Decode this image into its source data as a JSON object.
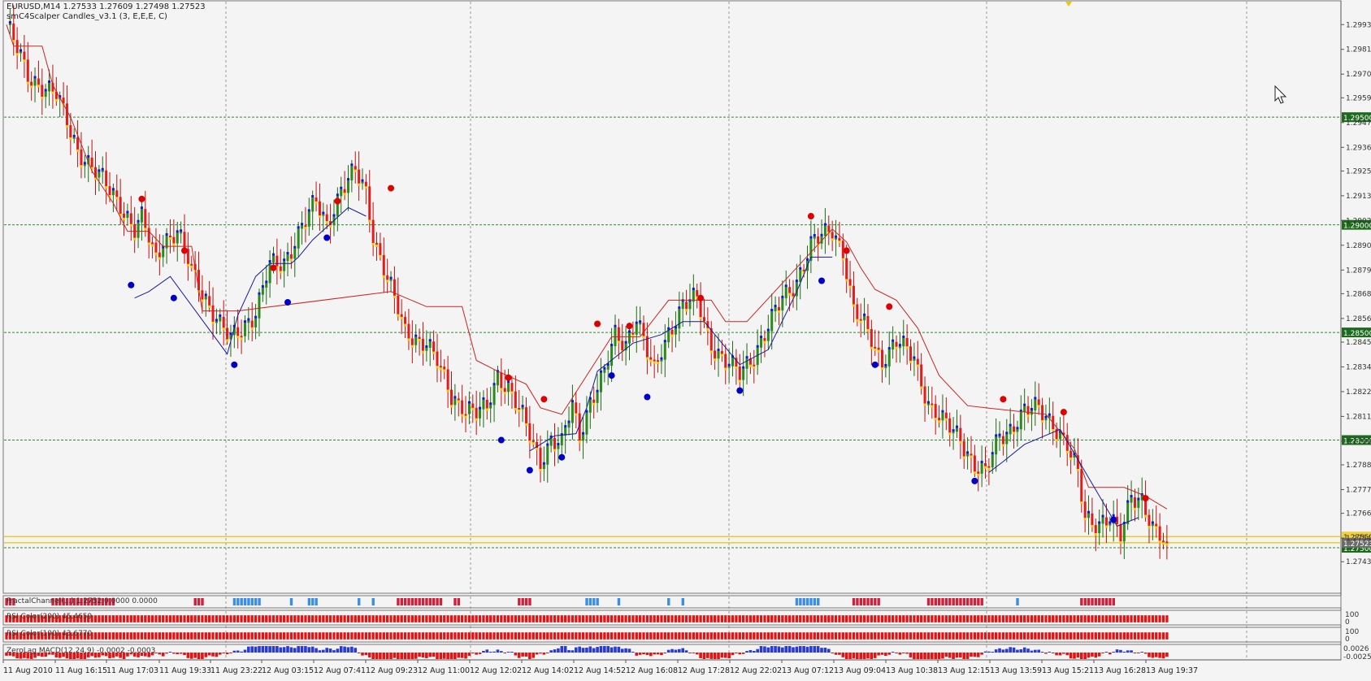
{
  "chart": {
    "symbol_line": "EURUSD,M14  1.27533 1.27609 1.27498 1.27523",
    "indicator_line": "smC4Scalper Candles_v3.1 (3, E,E,E, C)",
    "current_price": "1.27523",
    "colors": {
      "bull": "#2a8a1c",
      "bear": "#e31b1b",
      "wick": "#c01010",
      "trail_red": "#cc2222",
      "trail_blue": "#1a1a9c",
      "dot_red": "#e00000",
      "dot_blue": "#0000cc",
      "tick_gold": "#f0c800",
      "grid_h": "#2f8a2f",
      "box_green": "#1c6b1c"
    }
  },
  "chart_data": {
    "type": "candlestick",
    "title": "EURUSD,M14",
    "ylim": [
      1.27315,
      1.29999
    ],
    "price_labels": [
      "1.29930",
      "1.29815",
      "1.29700",
      "1.29590",
      "1.29475",
      "1.29360",
      "1.29250",
      "1.29135",
      "1.29020",
      "1.28905",
      "1.28790",
      "1.28680",
      "1.28565",
      "1.28455",
      "1.28340",
      "1.28225",
      "1.28110",
      "1.27995",
      "1.27885",
      "1.27770",
      "1.27660",
      "1.27545",
      "1.27435"
    ],
    "levels": [
      {
        "value": 1.295,
        "label": "1.29500"
      },
      {
        "value": 1.29,
        "label": "1.29000"
      },
      {
        "value": 1.285,
        "label": "1.28500"
      },
      {
        "value": 1.28,
        "label": "1.28000"
      },
      {
        "value": 1.275,
        "label": "1.27500"
      }
    ],
    "yellow_levels": [
      {
        "value": 1.27552,
        "label": "1.27552"
      },
      {
        "value": 1.27523,
        "label": "1.27523"
      }
    ],
    "time_labels": [
      "11 Aug 2010",
      "11 Aug 16:15",
      "11 Aug 17:03",
      "11 Aug 19:33",
      "11 Aug 23:22",
      "12 Aug 03:15",
      "12 Aug 07:41",
      "12 Aug 09:23",
      "12 Aug 11:00",
      "12 Aug 12:02",
      "12 Aug 14:02",
      "12 Aug 14:52",
      "12 Aug 16:08",
      "12 Aug 17:28",
      "12 Aug 22:02",
      "13 Aug 07:12",
      "13 Aug 09:04",
      "13 Aug 10:38",
      "13 Aug 12:15",
      "13 Aug 13:59",
      "13 Aug 15:21",
      "13 Aug 16:28",
      "13 Aug 19:37"
    ],
    "close_path": [
      [
        0,
        1.2993
      ],
      [
        6,
        1.2969
      ],
      [
        14,
        1.296
      ],
      [
        20,
        1.2935
      ],
      [
        26,
        1.2922
      ],
      [
        32,
        1.291
      ],
      [
        36,
        1.2897
      ],
      [
        38,
        1.2902
      ],
      [
        42,
        1.2885
      ],
      [
        44,
        1.2893
      ],
      [
        48,
        1.2896
      ],
      [
        52,
        1.2879
      ],
      [
        56,
        1.2866
      ],
      [
        60,
        1.2853
      ],
      [
        63,
        1.2846
      ],
      [
        65,
        1.285
      ],
      [
        70,
        1.2859
      ],
      [
        74,
        1.288
      ],
      [
        78,
        1.2882
      ],
      [
        82,
        1.2896
      ],
      [
        87,
        1.291
      ],
      [
        90,
        1.29
      ],
      [
        94,
        1.2916
      ],
      [
        98,
        1.2924
      ],
      [
        101,
        1.2915
      ],
      [
        103,
        1.2896
      ],
      [
        108,
        1.287
      ],
      [
        112,
        1.285
      ],
      [
        118,
        1.2845
      ],
      [
        121,
        1.2836
      ],
      [
        125,
        1.282
      ],
      [
        132,
        1.2812
      ],
      [
        135,
        1.2814
      ],
      [
        138,
        1.283
      ],
      [
        141,
        1.2825
      ],
      [
        146,
        1.2806
      ],
      [
        150,
        1.279
      ],
      [
        153,
        1.28
      ],
      [
        156,
        1.2797
      ],
      [
        159,
        1.2816
      ],
      [
        161,
        1.2802
      ],
      [
        164,
        1.2818
      ],
      [
        168,
        1.283
      ],
      [
        171,
        1.2848
      ],
      [
        174,
        1.2845
      ],
      [
        177,
        1.2857
      ],
      [
        180,
        1.284
      ],
      [
        182,
        1.2832
      ],
      [
        186,
        1.285
      ],
      [
        190,
        1.2862
      ],
      [
        194,
        1.2865
      ],
      [
        198,
        1.2845
      ],
      [
        202,
        1.2836
      ],
      [
        206,
        1.283
      ],
      [
        210,
        1.284
      ],
      [
        214,
        1.2852
      ],
      [
        218,
        1.2865
      ],
      [
        222,
        1.2874
      ],
      [
        226,
        1.289
      ],
      [
        230,
        1.2895
      ],
      [
        232,
        1.2898
      ],
      [
        235,
        1.2888
      ],
      [
        238,
        1.286
      ],
      [
        242,
        1.285
      ],
      [
        246,
        1.2837
      ],
      [
        250,
        1.2845
      ],
      [
        255,
        1.2838
      ],
      [
        259,
        1.2817
      ],
      [
        263,
        1.2808
      ],
      [
        268,
        1.2801
      ],
      [
        272,
        1.2788
      ],
      [
        275,
        1.2784
      ],
      [
        279,
        1.2802
      ],
      [
        282,
        1.2805
      ],
      [
        286,
        1.2812
      ],
      [
        290,
        1.2815
      ],
      [
        294,
        1.2808
      ],
      [
        298,
        1.2796
      ],
      [
        301,
        1.2784
      ],
      [
        303,
        1.2765
      ],
      [
        307,
        1.2761
      ],
      [
        310,
        1.2762
      ],
      [
        313,
        1.2755
      ],
      [
        316,
        1.2775
      ],
      [
        319,
        1.2772
      ],
      [
        322,
        1.2757
      ],
      [
        326,
        1.2752
      ]
    ],
    "trail_red_path": [
      [
        0,
        1.2993
      ],
      [
        2,
        1.2983
      ],
      [
        10,
        1.2983
      ],
      [
        13,
        1.2965
      ],
      [
        18,
        1.295
      ],
      [
        24,
        1.2925
      ],
      [
        30,
        1.291
      ],
      [
        34,
        1.2897
      ],
      [
        40,
        1.2897
      ],
      [
        44,
        1.289
      ],
      [
        52,
        1.289
      ],
      [
        55,
        1.286
      ],
      [
        65,
        1.286
      ],
      [
        108,
        1.2869
      ],
      [
        118,
        1.2862
      ],
      [
        128,
        1.2862
      ],
      [
        132,
        1.2837
      ],
      [
        138,
        1.2832
      ],
      [
        146,
        1.2826
      ],
      [
        150,
        1.2815
      ],
      [
        156,
        1.2812
      ],
      [
        170,
        1.2848
      ],
      [
        178,
        1.2848
      ],
      [
        186,
        1.2865
      ],
      [
        198,
        1.2865
      ],
      [
        202,
        1.2855
      ],
      [
        208,
        1.2855
      ],
      [
        232,
        1.2898
      ],
      [
        236,
        1.2892
      ],
      [
        240,
        1.288
      ],
      [
        244,
        1.287
      ],
      [
        250,
        1.2865
      ],
      [
        256,
        1.2852
      ],
      [
        262,
        1.283
      ],
      [
        270,
        1.2816
      ],
      [
        275,
        1.2815
      ],
      [
        292,
        1.2812
      ],
      [
        300,
        1.2796
      ],
      [
        304,
        1.2778
      ],
      [
        314,
        1.2778
      ],
      [
        320,
        1.2774
      ],
      [
        326,
        1.2768
      ]
    ],
    "trail_blue_path": [
      [
        36,
        1.2866
      ],
      [
        40,
        1.2869
      ],
      [
        46,
        1.2876
      ],
      [
        62,
        1.284
      ],
      [
        65,
        1.2858
      ],
      [
        70,
        1.2876
      ],
      [
        74,
        1.2882
      ],
      [
        80,
        1.2882
      ],
      [
        82,
        1.2885
      ],
      [
        86,
        1.2893
      ],
      [
        96,
        1.2908
      ],
      [
        101,
        1.2904
      ],
      [
        147,
        1.2795
      ],
      [
        154,
        1.2802
      ],
      [
        160,
        1.2803
      ],
      [
        163,
        1.2815
      ],
      [
        166,
        1.2832
      ],
      [
        176,
        1.2845
      ],
      [
        184,
        1.2849
      ],
      [
        190,
        1.2855
      ],
      [
        196,
        1.2855
      ],
      [
        206,
        1.2835
      ],
      [
        214,
        1.2842
      ],
      [
        222,
        1.2869
      ],
      [
        226,
        1.2885
      ],
      [
        232,
        1.2885
      ],
      [
        276,
        1.2785
      ],
      [
        280,
        1.279
      ],
      [
        286,
        1.2798
      ],
      [
        296,
        1.2805
      ],
      [
        312,
        1.276
      ],
      [
        318,
        1.2764
      ]
    ],
    "signal_dots": [
      {
        "i": 38,
        "v": 1.2912,
        "c": "red"
      },
      {
        "i": 50,
        "v": 1.2888,
        "c": "red"
      },
      {
        "i": 75,
        "v": 1.288,
        "c": "red"
      },
      {
        "i": 93,
        "v": 1.2911,
        "c": "red"
      },
      {
        "i": 108,
        "v": 1.2917,
        "c": "red"
      },
      {
        "i": 141,
        "v": 1.2829,
        "c": "red"
      },
      {
        "i": 151,
        "v": 1.2819,
        "c": "red"
      },
      {
        "i": 166,
        "v": 1.2854,
        "c": "red"
      },
      {
        "i": 175,
        "v": 1.2853,
        "c": "red"
      },
      {
        "i": 195,
        "v": 1.2866,
        "c": "red"
      },
      {
        "i": 226,
        "v": 1.2904,
        "c": "red"
      },
      {
        "i": 236,
        "v": 1.2888,
        "c": "red"
      },
      {
        "i": 248,
        "v": 1.2862,
        "c": "red"
      },
      {
        "i": 280,
        "v": 1.2819,
        "c": "red"
      },
      {
        "i": 297,
        "v": 1.2813,
        "c": "red"
      },
      {
        "i": 320,
        "v": 1.2773,
        "c": "red"
      },
      {
        "i": 35,
        "v": 1.2872,
        "c": "blue"
      },
      {
        "i": 47,
        "v": 1.2866,
        "c": "blue"
      },
      {
        "i": 64,
        "v": 1.2835,
        "c": "blue"
      },
      {
        "i": 79,
        "v": 1.2864,
        "c": "blue"
      },
      {
        "i": 90,
        "v": 1.2894,
        "c": "blue"
      },
      {
        "i": 139,
        "v": 1.28,
        "c": "blue"
      },
      {
        "i": 147,
        "v": 1.2786,
        "c": "blue"
      },
      {
        "i": 156,
        "v": 1.2792,
        "c": "blue"
      },
      {
        "i": 170,
        "v": 1.283,
        "c": "blue"
      },
      {
        "i": 180,
        "v": 1.282,
        "c": "blue"
      },
      {
        "i": 206,
        "v": 1.2823,
        "c": "blue"
      },
      {
        "i": 229,
        "v": 1.2874,
        "c": "blue"
      },
      {
        "i": 244,
        "v": 1.2835,
        "c": "blue"
      },
      {
        "i": 272,
        "v": 1.2781,
        "c": "blue"
      },
      {
        "i": 311,
        "v": 1.2763,
        "c": "blue"
      }
    ]
  },
  "panels": {
    "fractal": {
      "label": "FractalChannel(...) 1.2752 0.0000 0.0000",
      "marks": [
        {
          "from": 0,
          "to": 2,
          "c": "red"
        },
        {
          "from": 13,
          "to": 30,
          "c": "red"
        },
        {
          "from": 53,
          "to": 55,
          "c": "red"
        },
        {
          "from": 64,
          "to": 71,
          "c": "blue"
        },
        {
          "from": 80,
          "to": 80,
          "c": "blue"
        },
        {
          "from": 85,
          "to": 87,
          "c": "blue"
        },
        {
          "from": 99,
          "to": 99,
          "c": "blue"
        },
        {
          "from": 103,
          "to": 103,
          "c": "blue"
        },
        {
          "from": 110,
          "to": 122,
          "c": "red"
        },
        {
          "from": 126,
          "to": 127,
          "c": "red"
        },
        {
          "from": 144,
          "to": 147,
          "c": "red"
        },
        {
          "from": 163,
          "to": 166,
          "c": "blue"
        },
        {
          "from": 172,
          "to": 172,
          "c": "blue"
        },
        {
          "from": 186,
          "to": 186,
          "c": "blue"
        },
        {
          "from": 190,
          "to": 190,
          "c": "blue"
        },
        {
          "from": 222,
          "to": 228,
          "c": "blue"
        },
        {
          "from": 238,
          "to": 245,
          "c": "red"
        },
        {
          "from": 259,
          "to": 274,
          "c": "red"
        },
        {
          "from": 284,
          "to": 284,
          "c": "blue"
        },
        {
          "from": 302,
          "to": 311,
          "c": "red"
        }
      ]
    },
    "rsi1": {
      "label": "RSI Color(200) 45.4659",
      "scale_top": "100",
      "scale_bottom": "0"
    },
    "rsi2": {
      "label": "RSI Color(100) 43.6770",
      "scale_top": "100",
      "scale_bottom": "0"
    },
    "macd": {
      "label": "ZeroLag MACD(12,24,9) -0.0002 -0.0003",
      "scale_top": "0.0026",
      "scale_bottom": "-0.0025"
    }
  }
}
